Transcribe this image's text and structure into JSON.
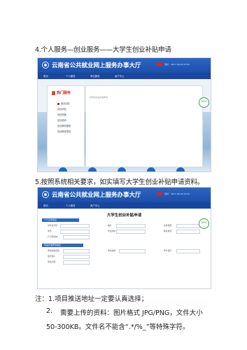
{
  "heading1": "4.个人服务—创业服务——大学生创业补贴申请",
  "heading2": "5.按照系统相关要求，如实填写大学生创业补贴申请资料。",
  "shot1": {
    "title": "云南省公共就业网上服务办事大厅",
    "user_text": "您好 · 2017-08-03 09:00",
    "nav": [
      "首页",
      "个人服务",
      "单位服务",
      "用户中心"
    ],
    "hot_title": "热门服务",
    "menu": [
      "就业创业",
      "创业补贴",
      "创业担保",
      "创业培训",
      "创业孵化基地",
      "创业孵化项目"
    ],
    "panel_note": "大学生创业补贴申请",
    "badge": "50%"
  },
  "shot2": {
    "title": "云南省公共就业网上服务办事大厅",
    "user_text": "您好 · 2017-08-03 09:00",
    "nav": [
      "首页",
      "个人服务",
      "用户中心"
    ],
    "form_title": "大学生创业补贴申请",
    "section1": "个人基本信息",
    "section2": "创业补贴申请信息",
    "fields1": [
      "身份证号码",
      "姓名",
      "证件类型",
      "学历",
      "毕业院校",
      "联系电话",
      "户口所在地"
    ],
    "fields2": [
      "申请补贴项目",
      "申请金额",
      "开户银行",
      "银行账户",
      "申请日期"
    ],
    "badge": "50%"
  },
  "note": {
    "line1": "注：1.项目推送地址一定要认真选择；",
    "line2_num": "2.",
    "line2": "需要上传的资料：图片格式 JPG/PNG，文件大小",
    "line3": "50-300KB。文件名不能含“.*/%_”等特殊字符。"
  },
  "colors": {
    "header_blue": "#2a66c4",
    "nav_blue": "#1846a0",
    "accent_red": "#e32020",
    "badge_green": "#3a9a4c"
  }
}
